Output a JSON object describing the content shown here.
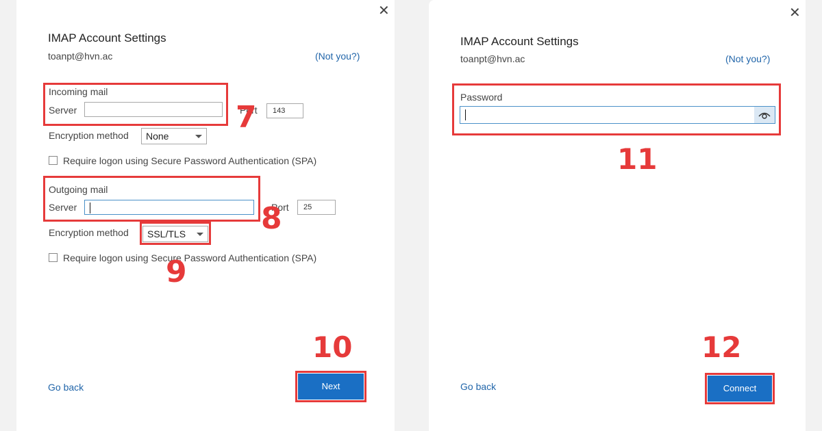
{
  "left_panel": {
    "close_glyph": "✕",
    "title": "IMAP Account Settings",
    "email": "toanpt@hvn.ac",
    "not_you": "(Not you?)",
    "incoming": {
      "heading": "Incoming mail",
      "server_label": "Server",
      "server_value": "",
      "port_label": "Port",
      "port_value": "143",
      "encryption_label": "Encryption method",
      "encryption_value": "None",
      "spa_label": "Require logon using Secure Password Authentication (SPA)"
    },
    "outgoing": {
      "heading": "Outgoing mail",
      "server_label": "Server",
      "server_value": "",
      "port_label": "Port",
      "port_value": "25",
      "encryption_label": "Encryption method",
      "encryption_value": "SSL/TLS",
      "spa_label": "Require logon using Secure Password Authentication (SPA)"
    },
    "go_back": "Go back",
    "next_button": "Next"
  },
  "right_panel": {
    "close_glyph": "✕",
    "title": "IMAP Account Settings",
    "email": "toanpt@hvn.ac",
    "not_you": "(Not you?)",
    "password_label": "Password",
    "password_value": "",
    "go_back": "Go back",
    "connect_button": "Connect"
  },
  "annotations": {
    "step_7": "7",
    "step_8": "8",
    "step_9": "9",
    "step_10": "10",
    "step_11": "11",
    "step_12": "12"
  },
  "colors": {
    "highlight": "#e63a3a",
    "primary_button": "#1a6fc4",
    "link": "#2266aa"
  }
}
